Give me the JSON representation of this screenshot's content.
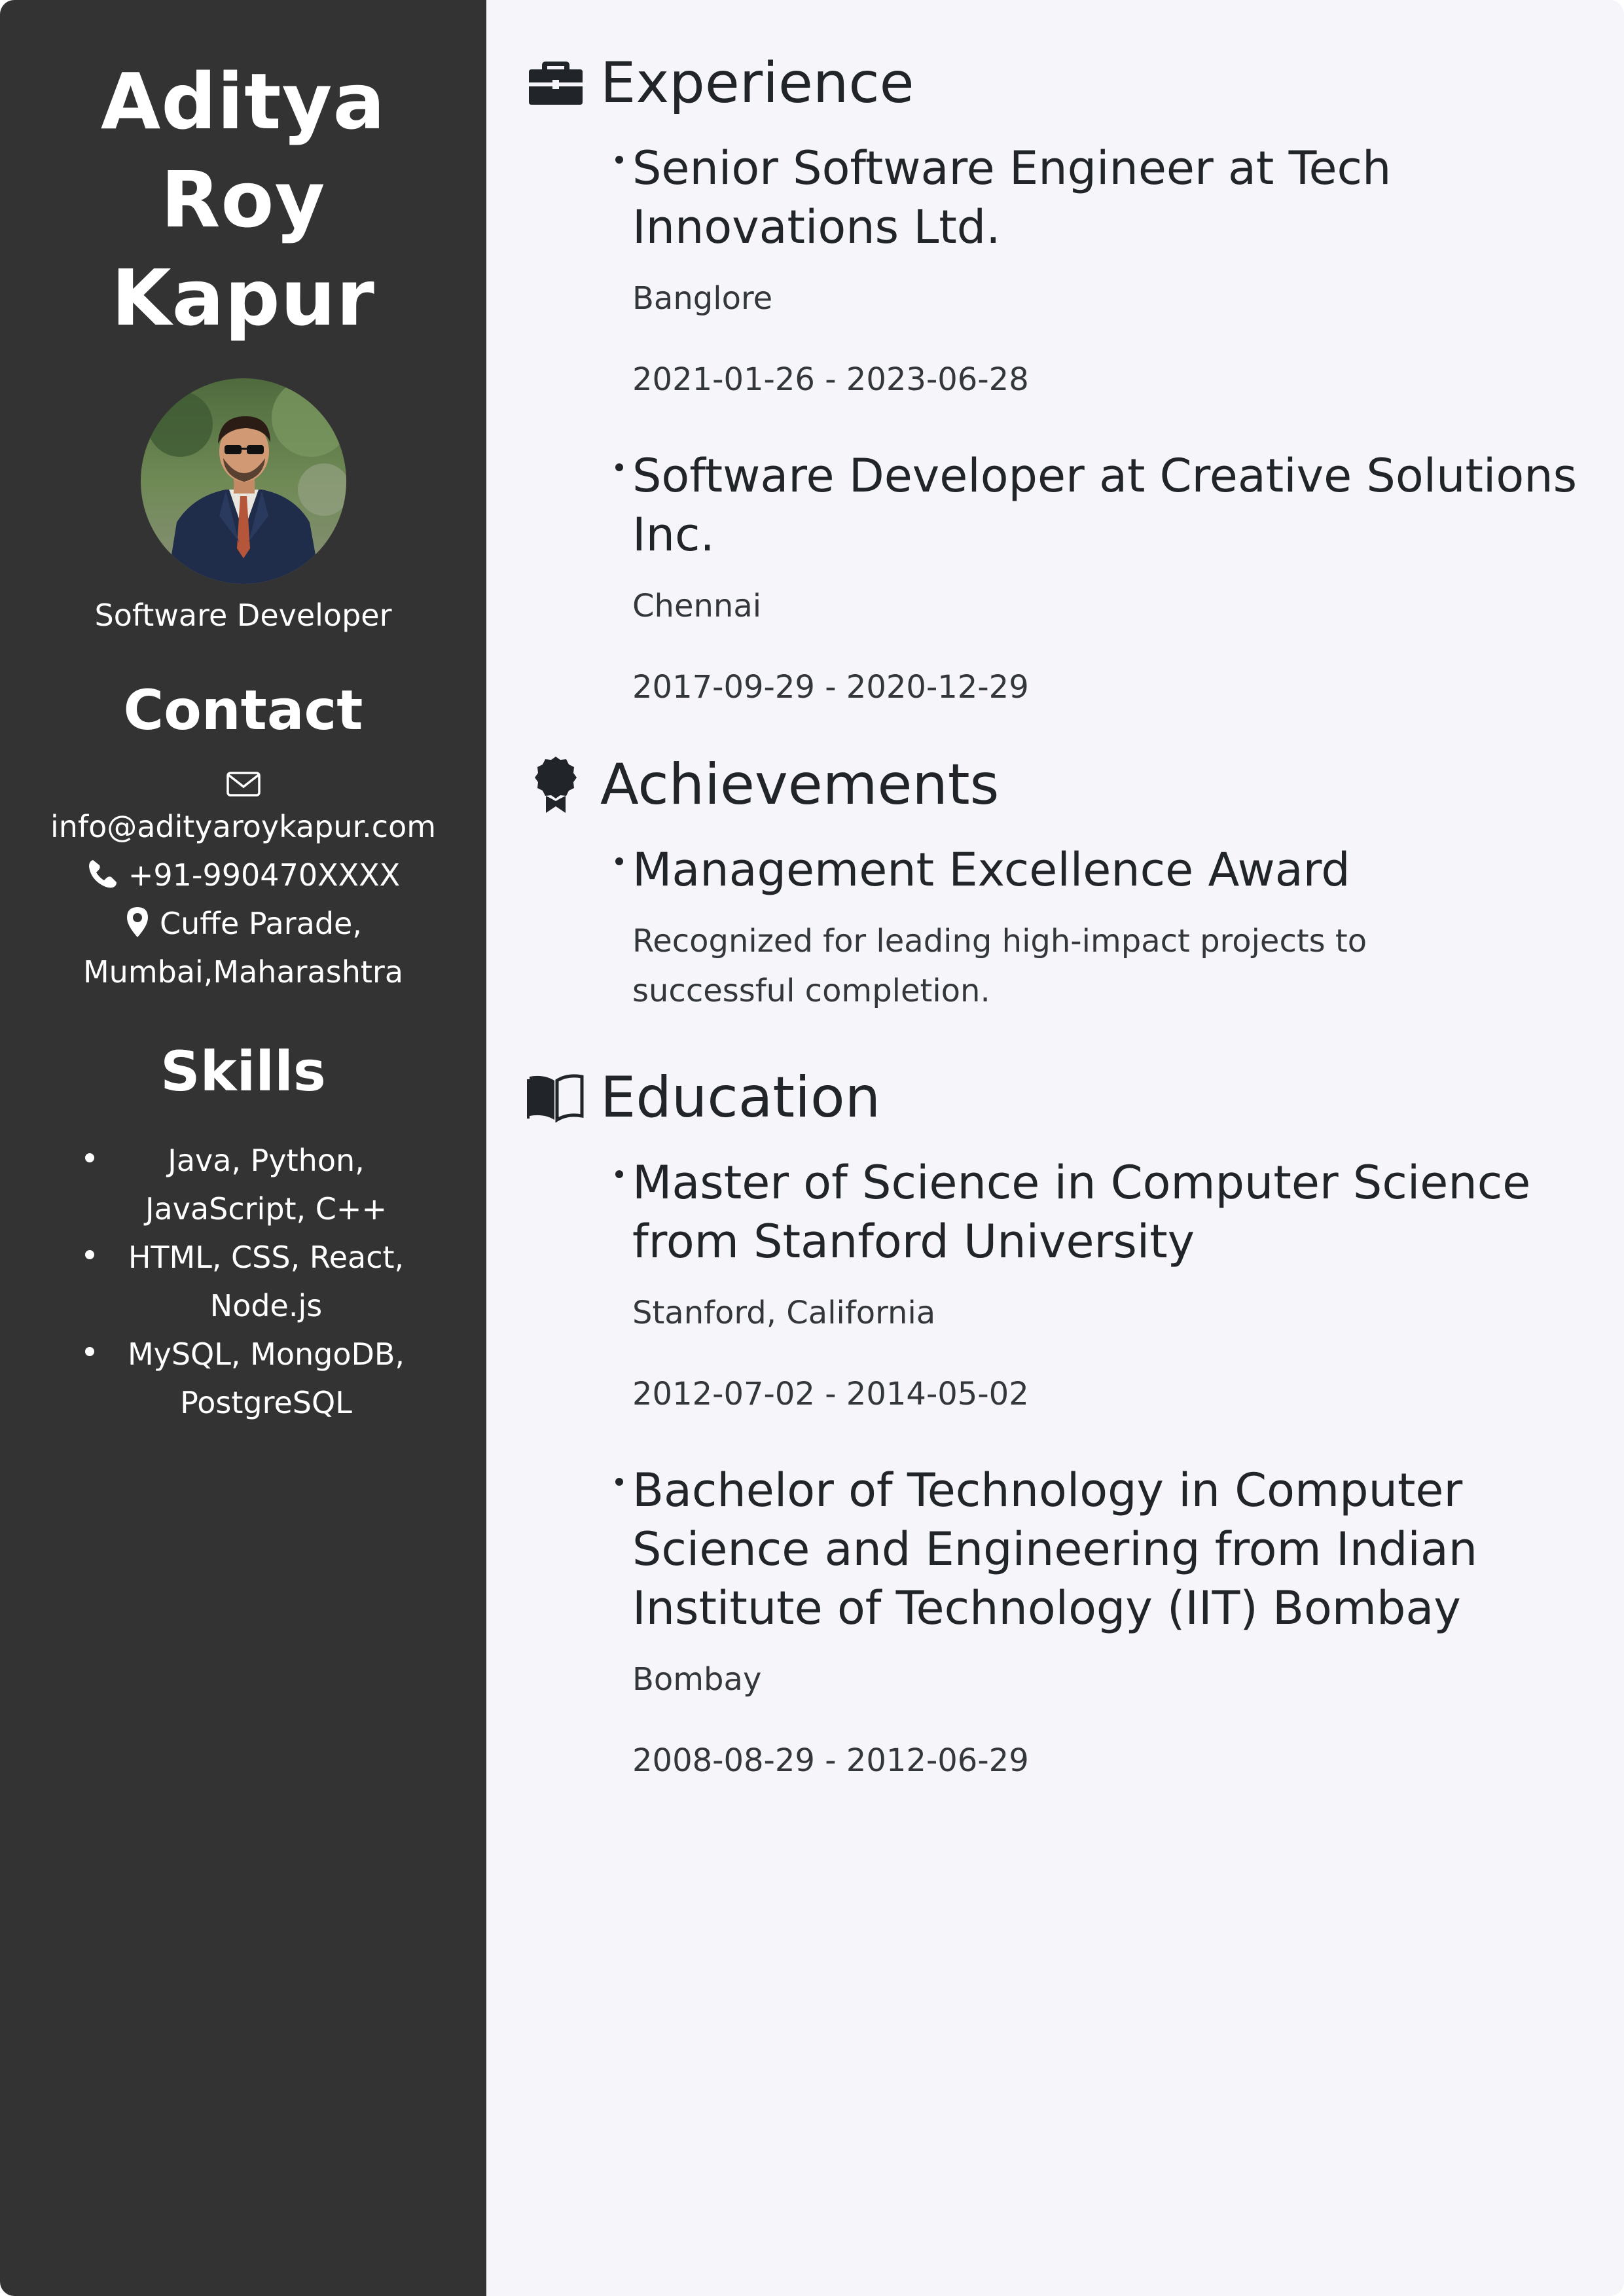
{
  "sidebar": {
    "name_line1": "Aditya Roy",
    "name_line2": "Kapur",
    "role": "Software Developer",
    "contact": {
      "heading": "Contact",
      "email": "info@adityaroykapur.com",
      "phone": "+91-990470XXXX",
      "address_line1": "Cuffe Parade,",
      "address_line2": "Mumbai,Maharashtra",
      "email_icon": "envelope-icon",
      "phone_icon": "phone-icon",
      "address_icon": "map-pin-icon"
    },
    "skills": {
      "heading": "Skills",
      "items": [
        {
          "line1": "Java, Python,",
          "line2": "JavaScript, C++"
        },
        {
          "line1": "HTML, CSS, React,",
          "line2": "Node.js"
        },
        {
          "line1": "MySQL, MongoDB,",
          "line2": "PostgreSQL"
        }
      ]
    }
  },
  "main": {
    "experience": {
      "heading": "Experience",
      "icon": "briefcase-icon",
      "items": [
        {
          "title": "Senior Software Engineer at Tech Innovations Ltd.",
          "location": "Banglore",
          "dates": "2021-01-26 - 2023-06-28"
        },
        {
          "title": "Software Developer at Creative Solutions Inc.",
          "location": "Chennai",
          "dates": "2017-09-29 - 2020-12-29"
        }
      ]
    },
    "achievements": {
      "heading": "Achievements",
      "icon": "award-icon",
      "items": [
        {
          "title": "Management Excellence Award",
          "description": "Recognized for leading high-impact projects to successful completion."
        }
      ]
    },
    "education": {
      "heading": "Education",
      "icon": "book-icon",
      "items": [
        {
          "title": "Master of Science in Computer Science from Stanford University",
          "location": "Stanford, California",
          "dates": "2012-07-02 - 2014-05-02"
        },
        {
          "title": "Bachelor of Technology in Computer Science and Engineering from Indian Institute of Technology (IIT) Bombay",
          "location": "Bombay",
          "dates": "2008-08-29 - 2012-06-29"
        }
      ]
    }
  },
  "colors": {
    "sidebar_bg": "#333333",
    "main_bg": "#f5f5fa",
    "text_dark": "#212529"
  }
}
